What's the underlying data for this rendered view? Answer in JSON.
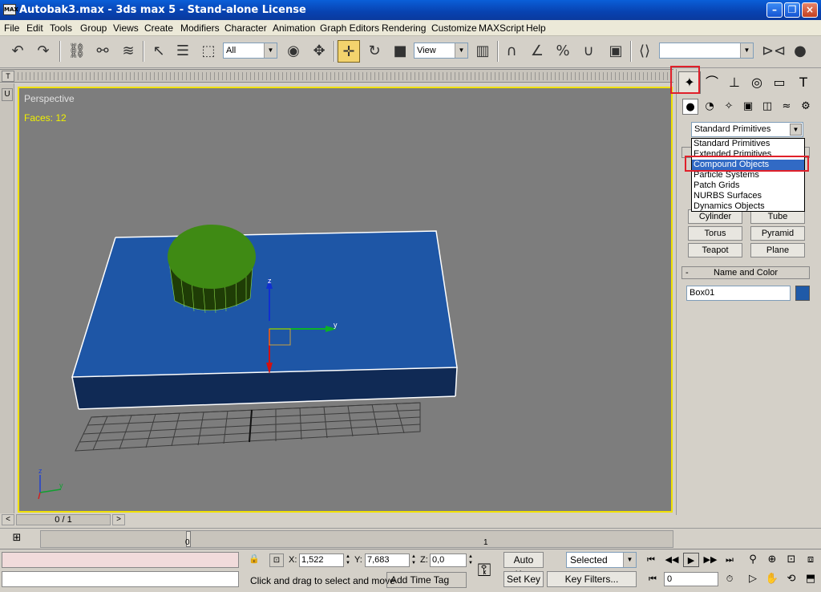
{
  "window": {
    "title": "Autobak3.max - 3ds max 5 - Stand-alone License",
    "app_icon_text": "MAX"
  },
  "menu": [
    "File",
    "Edit",
    "Tools",
    "Group",
    "Views",
    "Create",
    "Modifiers",
    "Character",
    "Animation",
    "Graph Editors",
    "Rendering",
    "Customize",
    "MAXScript",
    "Help"
  ],
  "toolbar": {
    "selection_filter": "All",
    "reference_coord": "View",
    "named_selection": ""
  },
  "track": {
    "t_label": "T"
  },
  "left": {
    "u_label": "U"
  },
  "viewport": {
    "label": "Perspective",
    "faces": "Faces: 12",
    "axis_x": "x",
    "axis_y": "y",
    "axis_z": "z"
  },
  "command_panel": {
    "category_selected": "Standard Primitives",
    "category_options": [
      "Standard Primitives",
      "Extended Primitives",
      "Compound Objects",
      "Particle Systems",
      "Patch Grids",
      "NURBS Surfaces",
      "Dynamics Objects"
    ],
    "selected_option": "Compound Objects",
    "object_buttons": [
      "Cylinder",
      "Tube",
      "Torus",
      "Pyramid",
      "Teapot",
      "Plane"
    ],
    "name_color_title": "Name and Color",
    "rollout_minus": "-",
    "object_name": "Box01",
    "object_color": "#1f5aa8"
  },
  "timeslider": {
    "frame": "0 / 1",
    "prev": "<",
    "next": ">"
  },
  "timeline": {
    "label_start": "0",
    "label_end": "1"
  },
  "status": {
    "x_label": "X:",
    "x_value": "1,522",
    "y_label": "Y:",
    "y_value": "7,683",
    "z_label": "Z:",
    "z_value": "0,0",
    "prompt": "Click and drag to select and move",
    "add_time_tag": "Add Time Tag",
    "auto_key": "Auto Key",
    "set_key": "Set Key",
    "key_mode": "Selected",
    "key_filters": "Key Filters...",
    "current_frame": "0"
  }
}
